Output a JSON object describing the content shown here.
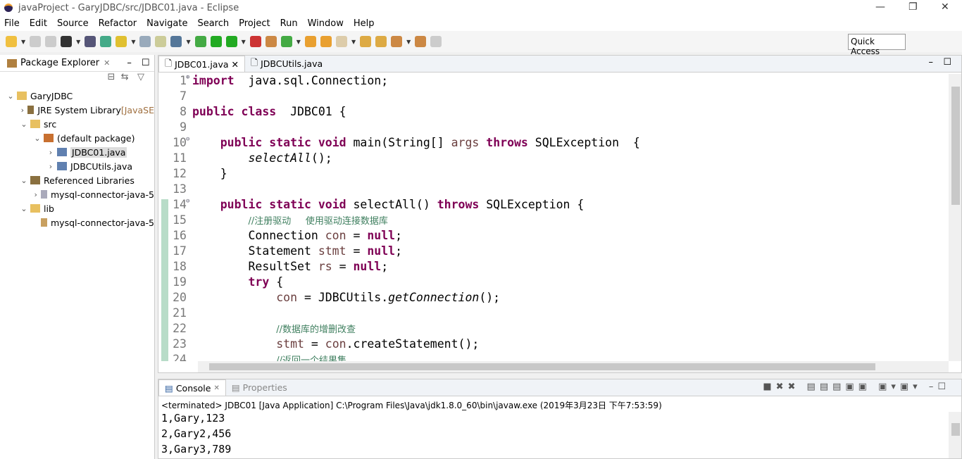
{
  "window": {
    "title": "javaProject - GaryJDBC/src/JDBC01.java - Eclipse"
  },
  "menu": [
    "File",
    "Edit",
    "Source",
    "Refactor",
    "Navigate",
    "Search",
    "Project",
    "Run",
    "Window",
    "Help"
  ],
  "quick_access": "Quick Access",
  "package_explorer": {
    "title": "Package Explorer",
    "tree": [
      {
        "label": "GaryJDBC",
        "depth": 0,
        "arrow": "v",
        "icon": "project-folder"
      },
      {
        "label": "JRE System Library",
        "extra": " [JavaSE",
        "depth": 1,
        "arrow": ">",
        "icon": "library"
      },
      {
        "label": "src",
        "depth": 1,
        "arrow": "v",
        "icon": "source-folder"
      },
      {
        "label": "(default package)",
        "depth": 2,
        "arrow": "v",
        "icon": "package"
      },
      {
        "label": "JDBC01.java",
        "depth": 3,
        "arrow": ">",
        "icon": "java-file",
        "selected": true
      },
      {
        "label": "JDBCUtils.java",
        "depth": 3,
        "arrow": ">",
        "icon": "java-file"
      },
      {
        "label": "Referenced Libraries",
        "depth": 1,
        "arrow": "v",
        "icon": "library"
      },
      {
        "label": "mysql-connector-java-5",
        "depth": 2,
        "arrow": ">",
        "icon": "jar"
      },
      {
        "label": "lib",
        "depth": 1,
        "arrow": "v",
        "icon": "folder"
      },
      {
        "label": "mysql-connector-java-5",
        "depth": 2,
        "arrow": "",
        "icon": "jar-file"
      }
    ]
  },
  "editor": {
    "tabs": [
      "JDBC01.java",
      "JDBCUtils.java"
    ],
    "lines": [
      {
        "n": "1",
        "fold": "+",
        "t": [
          [
            "kw",
            "import"
          ],
          [
            "",
            "  java.sql.Connection;"
          ]
        ]
      },
      {
        "n": "7",
        "t": []
      },
      {
        "n": "8",
        "t": [
          [
            "kw",
            "public class"
          ],
          [
            "",
            "  JDBC01 {"
          ]
        ]
      },
      {
        "n": "9",
        "t": []
      },
      {
        "n": "10",
        "fold": "-",
        "t": [
          [
            "",
            "    "
          ],
          [
            "kw",
            "public static void"
          ],
          [
            "",
            " main(String[] "
          ],
          [
            "var",
            "args"
          ],
          [
            "",
            " "
          ],
          [
            "kw",
            "throws"
          ],
          [
            "",
            " SQLException  {"
          ]
        ]
      },
      {
        "n": "11",
        "t": [
          [
            "",
            "        "
          ],
          [
            "it",
            "selectAll"
          ],
          [
            "",
            "();"
          ]
        ]
      },
      {
        "n": "12",
        "t": [
          [
            "",
            "    }"
          ]
        ]
      },
      {
        "n": "13",
        "t": []
      },
      {
        "n": "14",
        "fold": "-",
        "t": [
          [
            "",
            "    "
          ],
          [
            "kw",
            "public static void"
          ],
          [
            "",
            " selectAll() "
          ],
          [
            "kw",
            "throws"
          ],
          [
            "",
            " SQLException {"
          ]
        ]
      },
      {
        "n": "15",
        "t": [
          [
            "",
            "        "
          ],
          [
            "cm",
            "//注册驱动     使用驱动连接数据库"
          ]
        ]
      },
      {
        "n": "16",
        "t": [
          [
            "",
            "        Connection "
          ],
          [
            "var",
            "con"
          ],
          [
            "",
            " = "
          ],
          [
            "kw",
            "null"
          ],
          [
            "",
            ";"
          ]
        ]
      },
      {
        "n": "17",
        "t": [
          [
            "",
            "        Statement "
          ],
          [
            "var",
            "stmt"
          ],
          [
            "",
            " = "
          ],
          [
            "kw",
            "null"
          ],
          [
            "",
            ";"
          ]
        ]
      },
      {
        "n": "18",
        "t": [
          [
            "",
            "        ResultSet "
          ],
          [
            "var",
            "rs"
          ],
          [
            "",
            " = "
          ],
          [
            "kw",
            "null"
          ],
          [
            "",
            ";"
          ]
        ]
      },
      {
        "n": "19",
        "t": [
          [
            "",
            "        "
          ],
          [
            "kw",
            "try"
          ],
          [
            "",
            " {"
          ]
        ]
      },
      {
        "n": "20",
        "t": [
          [
            "",
            "            "
          ],
          [
            "var",
            "con"
          ],
          [
            "",
            " = JDBCUtils."
          ],
          [
            "it",
            "getConnection"
          ],
          [
            "",
            "();"
          ]
        ]
      },
      {
        "n": "21",
        "t": []
      },
      {
        "n": "22",
        "t": [
          [
            "",
            "            "
          ],
          [
            "cm",
            "//数据库的增删改查"
          ]
        ]
      },
      {
        "n": "23",
        "t": [
          [
            "",
            "            "
          ],
          [
            "var",
            "stmt"
          ],
          [
            "",
            " = "
          ],
          [
            "var",
            "con"
          ],
          [
            "",
            ".createStatement();"
          ]
        ]
      },
      {
        "n": "24",
        "t": [
          [
            "",
            "            "
          ],
          [
            "cm",
            "//返回一个结果集"
          ]
        ]
      }
    ]
  },
  "console": {
    "tabs": [
      "Console",
      "Properties"
    ],
    "status": "<terminated> JDBC01 [Java Application] C:\\Program Files\\Java\\jdk1.8.0_60\\bin\\javaw.exe (2019年3月23日 下午7:53:59)",
    "output": [
      "1,Gary,123",
      "2,Gary2,456",
      "3,Gary3,789"
    ]
  }
}
